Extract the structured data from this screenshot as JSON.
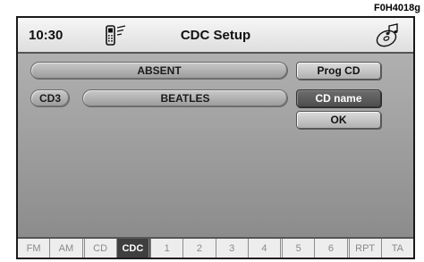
{
  "figure_code": "F0H4018g",
  "header": {
    "clock": "10:30",
    "title": "CDC Setup",
    "phone_icon": "phone-signal-icon",
    "disc_icon": "cd-music-icon"
  },
  "main": {
    "status_value": "ABSENT",
    "disc_label": "CD3",
    "disc_name": "BEATLES"
  },
  "buttons": {
    "prog_cd": "Prog CD",
    "cd_name": "CD name",
    "ok": "OK"
  },
  "tabs": [
    {
      "label": "FM"
    },
    {
      "label": "AM"
    },
    {
      "label": "CD"
    },
    {
      "label": "CDC"
    },
    {
      "label": "1"
    },
    {
      "label": "2"
    },
    {
      "label": "3"
    },
    {
      "label": "4"
    },
    {
      "label": "5"
    },
    {
      "label": "6"
    },
    {
      "label": "RPT"
    },
    {
      "label": "TA"
    }
  ],
  "active_tab": "CDC",
  "colors": {
    "screen_bg": "#9a9a9a",
    "active_tab_bg": "#3f3f3f",
    "selected_button_bg": "#5c5c5c"
  }
}
